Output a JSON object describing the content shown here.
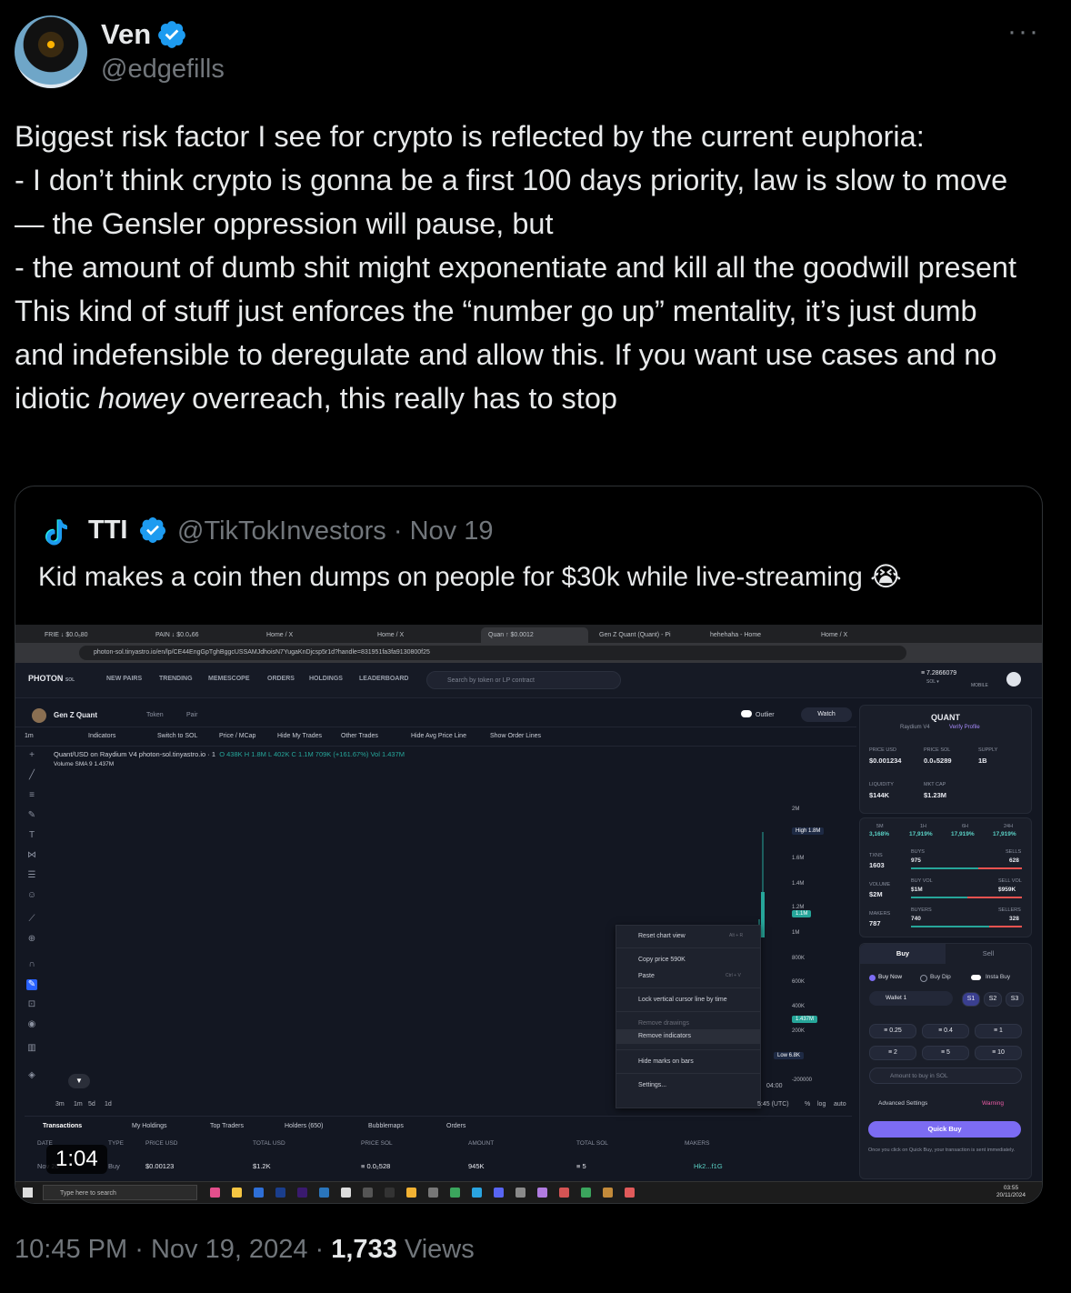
{
  "tweet": {
    "author_name": "Ven",
    "author_handle": "@edgefills",
    "more_glyph": "···",
    "body_lines": [
      "Biggest risk factor I see for crypto is reflected by the current euphoria:",
      "- I don’t think crypto is gonna be a first 100 days priority, law is slow to move — the Gensler oppression will pause, but",
      "- the amount of dumb shit might exponentiate and kill all the goodwill present"
    ],
    "body_last_before": "This kind of stuff just enforces the “number go up” mentality, it’s just dumb and indefensible to deregulate and allow this. If you want use cases and no idiotic ",
    "body_last_em": "howey",
    "body_last_after": " overreach, this really has to stop",
    "time": "10:45 PM",
    "date": "Nov 19, 2024",
    "views_count": "1,733",
    "views_label": "Views",
    "sep": "·",
    "colors": {
      "verified": "#1d9bf0",
      "text": "#e7e9ea",
      "muted": "#71767b",
      "background": "#000000"
    }
  },
  "quote": {
    "name": "TTI",
    "handle": "@TikTokInvestors",
    "date": "Nov 19",
    "sep": "·",
    "text": "Kid makes a coin then dumps on people for $30k while live-streaming 😭",
    "video_duration": "1:04"
  },
  "screenshot": {
    "tabs": [
      "FRIE ↓ $0.0₅80",
      "PAIN ↓ $0.0₄66",
      "Home / X",
      "Home / X",
      "Quan ↑ $0.0012",
      "Gen Z Quant (Quant) - Pi",
      "hehehaha - Home",
      "Home / X"
    ],
    "url": "photon-sol.tinyastro.io/en/lp/CE44EngGpTghBggcUSSAMJdhoisN7YugaKnDjcsp5r1d?handle=831951fa3fa9130800f25",
    "brand": "PHOTON",
    "brand_suffix": "SOL",
    "nav": [
      "NEW PAIRS",
      "TRENDING",
      "MEMESCOPE",
      "ORDERS",
      "HOLDINGS",
      "LEADERBOARD"
    ],
    "search_placeholder": "Search by token or LP contract",
    "sol_balance": "≡ 7.2866079",
    "sol_label": "SOL ▾",
    "mobile_label": "MOBILE",
    "token_name": "Gen Z Quant",
    "token_links": [
      "Token",
      "Pair"
    ],
    "outlier": "Outlier",
    "watch": "Watch",
    "toolbar": [
      "1m",
      "Indicators",
      "Switch to SOL",
      "Price / MCap",
      "Hide My Trades",
      "Other Trades",
      "Hide Avg Price Line",
      "Show Order Lines"
    ],
    "plot_title": "Quant/USD on Raydium V4 photon-sol.tinyastro.io · 1",
    "plot_ohlc": "O 438K H 1.8M L 402K C 1.1M 709K (+161.67%) Vol 1.437M",
    "volume_line": "Volume SMA 9  1.437M",
    "y_axis": [
      "2M",
      "1.6M",
      "1.4M",
      "1.2M",
      "1M",
      "800K",
      "600K",
      "400K",
      "200K",
      "-200000"
    ],
    "tags": {
      "high": "High  1.8M",
      "last": "1.1M",
      "vol": "1.437M",
      "low": "Low  6.8K"
    },
    "context_menu": {
      "reset": "Reset chart view",
      "reset_key": "Alt + R",
      "copy": "Copy price 590K",
      "paste": "Paste",
      "paste_key": "Ctrl + V",
      "lock": "Lock vertical cursor line by time",
      "remove_drawings": "Remove drawings",
      "remove_indicators": "Remove indicators",
      "hide_marks": "Hide marks on bars",
      "settings": "Settings..."
    },
    "time_ranges": [
      "3m",
      "1m",
      "5d",
      "1d"
    ],
    "time_label": "04:00",
    "tz": "5:45 (UTC)",
    "axis_opts": [
      "%",
      "log",
      "auto"
    ],
    "bottom_tabs": [
      "Transactions",
      "My Holdings",
      "Top Traders",
      "Holders (650)",
      "Bubblemaps",
      "Orders"
    ],
    "table_headers": [
      "DATE",
      "TYPE",
      "PRICE USD",
      "TOTAL USD",
      "PRICE SOL",
      "AMOUNT",
      "TOTAL SOL",
      "MAKERS"
    ],
    "table_row": [
      "Nov 20",
      "Buy",
      "$0.00123",
      "$1.2K",
      "≡ 0.0₂528",
      "945K",
      "≡ 5",
      "Hk2...f1G"
    ],
    "side": {
      "title": "QUANT",
      "subtitle": "Raydium V4",
      "verify": "Verify Profile",
      "stats": [
        {
          "label": "PRICE USD",
          "value": "$0.001234"
        },
        {
          "label": "PRICE SOL",
          "value": "0.0₅5289"
        },
        {
          "label": "SUPPLY",
          "value": "1B"
        },
        {
          "label": "LIQUIDITY",
          "value": "$144K"
        },
        {
          "label": "MKT CAP",
          "value": "$1.23M"
        }
      ],
      "periods": [
        {
          "label": "5M",
          "value": "3,168%"
        },
        {
          "label": "1H",
          "value": "17,919%"
        },
        {
          "label": "6H",
          "value": "17,919%"
        },
        {
          "label": "24H",
          "value": "17,919%"
        }
      ],
      "txns_label": "TXNS",
      "txns": "1603",
      "buys_label": "BUYS",
      "buys": "975",
      "sells_label": "SELLS",
      "sells": "628",
      "volume_label": "VOLUME",
      "volume": "$2M",
      "buyvol_label": "BUY VOL",
      "buyvol": "$1M",
      "sellvol_label": "SELL VOL",
      "sellvol": "$959K",
      "makers_label": "MAKERS",
      "makers": "787",
      "buyers_label": "BUYERS",
      "buyers": "740",
      "sellers_label": "SELLERS",
      "sellers": "328",
      "buy_tab": "Buy",
      "sell_tab": "Sell",
      "modes": [
        "Buy Now",
        "Buy Dip",
        "Insta Buy"
      ],
      "wallet": "Wallet 1",
      "slots": [
        "S1",
        "S2",
        "S3"
      ],
      "amounts": [
        "≡ 0.25",
        "≡ 0.4",
        "≡ 1",
        "≡ 2",
        "≡ 5",
        "≡ 10"
      ],
      "amount_placeholder": "Amount to buy in SOL",
      "advanced": "Advanced Settings",
      "warning": "Warning",
      "quick_buy": "Quick Buy",
      "note": "Once you click on Quick Buy, your transaction is sent immediately."
    },
    "taskbar_search": "Type here to search",
    "clock_time": "03:55",
    "clock_date": "20/11/2024"
  }
}
